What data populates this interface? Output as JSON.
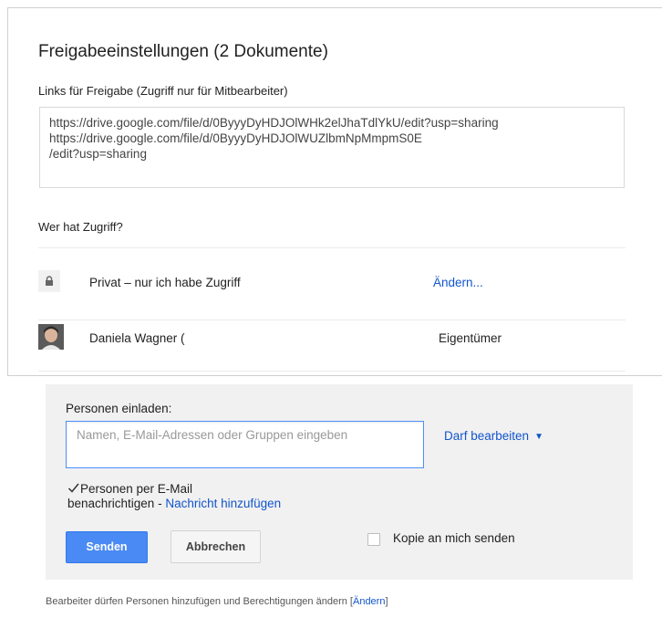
{
  "dialog": {
    "title": "Freigabeeinstellungen (2 Dokumente)"
  },
  "links": {
    "label": "Links für Freigabe (Zugriff nur für Mitbearbeiter)",
    "lines": [
      "https://drive.google.com/file/d/0ByyyDyHDJOlWHk2elJhaTdlYkU/edit?usp=sharing",
      "https://drive.google.com/file/d/0ByyyDyHDJOlWUZlbmNpMmpmS0E",
      "/edit?usp=sharing"
    ]
  },
  "access": {
    "label": "Wer hat Zugriff?",
    "privacy_text": "Privat – nur ich habe Zugriff",
    "change_label": "Ändern...",
    "owner_name": "Daniela Wagner (",
    "owner_role": "Eigentümer"
  },
  "invite": {
    "label": "Personen einladen:",
    "placeholder": "Namen, E-Mail-Adressen oder Gruppen eingeben",
    "permission": "Darf bearbeiten",
    "notify_line1": "Personen per E-Mail",
    "notify_line2": "benachrichtigen",
    "notify_sep": " - ",
    "add_message": "Nachricht hinzufügen",
    "notify_checked": true,
    "send_label": "Senden",
    "cancel_label": "Abbrechen",
    "copy_label": "Kopie an mich senden",
    "copy_checked": false
  },
  "footer": {
    "text": "Bearbeiter dürfen Personen hinzufügen und Berechtigungen ändern ",
    "bracket_open": "[",
    "link": "Ändern",
    "bracket_close": "]"
  },
  "icons": {
    "lock": "lock-icon",
    "checkmark": "checkmark-icon",
    "caret": "caret-down-icon",
    "avatar": "user-avatar"
  },
  "colors": {
    "link": "#1155cc",
    "primary_button": "#4a8af4",
    "panel_bg": "#f1f1f1",
    "input_focus": "#4d90fe"
  }
}
